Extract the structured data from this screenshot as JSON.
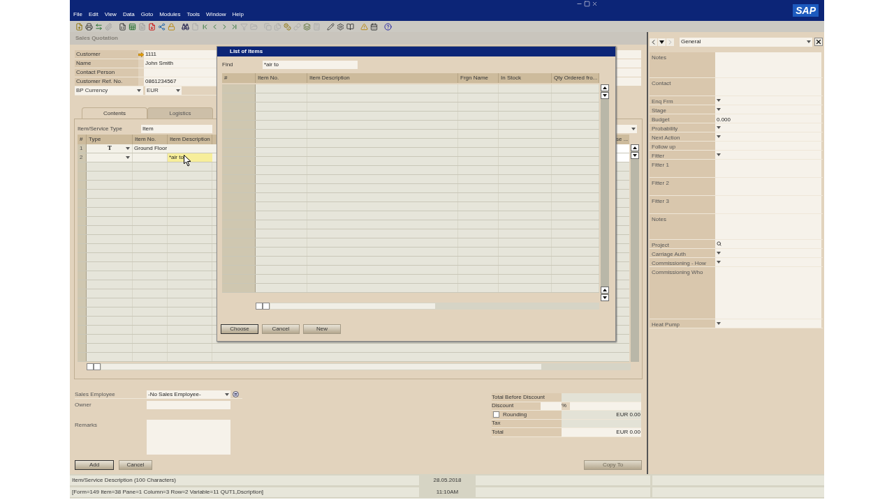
{
  "app": {
    "logo": "SAP"
  },
  "menu": [
    "File",
    "Edit",
    "View",
    "Data",
    "Goto",
    "Modules",
    "Tools",
    "Window",
    "Help"
  ],
  "sales_quotation": {
    "title": "Sales Quotation",
    "header_fields": [
      {
        "label": "Customer",
        "value": "1111",
        "kind": "link"
      },
      {
        "label": "Name",
        "value": "John Smith",
        "kind": "text"
      },
      {
        "label": "Contact Person",
        "kind": "text"
      },
      {
        "label": "Customer Ref. No.",
        "value": "0861234567",
        "kind": "text"
      },
      {
        "label": "BP Currency",
        "value": "EUR",
        "kind": "select"
      }
    ],
    "tabs": [
      {
        "label": "Contents",
        "selected": true
      },
      {
        "label": "Logistics",
        "selected": false
      }
    ],
    "item_service_type": {
      "label": "Item/Service Type",
      "value": "Item"
    },
    "grid": {
      "columns": [
        "#",
        "Type",
        "Item No.",
        "Item Description"
      ],
      "last_column": "se ...",
      "rows": [
        {
          "number": "1",
          "kind": "text",
          "type": "T",
          "item_no": "Ground Floor",
          "editing": false
        },
        {
          "number": "2",
          "kind": "item",
          "description": "*air to",
          "editing": true
        }
      ]
    },
    "sales_employee": {
      "label": "Sales Employee",
      "value": "-No Sales Employee-"
    },
    "owner": {
      "label": "Owner"
    },
    "remarks": {
      "label": "Remarks"
    },
    "totals": [
      {
        "label": "Total Before Discount",
        "kind": "readonly"
      },
      {
        "label": "Discount",
        "kind": "percent",
        "unit": "%"
      },
      {
        "label": "Rounding",
        "kind": "checkbox",
        "checked": false,
        "value": "EUR 0.00"
      },
      {
        "label": "Tax",
        "kind": "readonly"
      },
      {
        "label": "Total",
        "kind": "editable",
        "value": "EUR 0.00"
      }
    ],
    "buttons": [
      "Add",
      "Cancel"
    ],
    "copy_to": {
      "label": "Copy To",
      "disabled": true
    }
  },
  "list_of_items": {
    "title": "List of Items",
    "find": {
      "label": "Find",
      "value": "*air to"
    },
    "columns": [
      "#",
      "Item No.",
      "Item Description",
      "Frgn Name",
      "In Stock",
      "Qty Ordered fro..."
    ],
    "buttons": [
      "Choose",
      "Cancel",
      "New"
    ]
  },
  "side_panel": {
    "view": "General",
    "fields": [
      {
        "label": "Notes",
        "kind": "note"
      },
      {
        "label": "Contact",
        "kind": "box"
      },
      {
        "label": "Enq Frm",
        "kind": "select"
      },
      {
        "label": "Stage",
        "kind": "select"
      },
      {
        "label": "Budget",
        "kind": "line",
        "value": "0.000"
      },
      {
        "label": "Probability",
        "kind": "select"
      },
      {
        "label": "Next Action",
        "kind": "select"
      },
      {
        "label": "Follow up",
        "kind": "line"
      },
      {
        "label": "Fitter",
        "kind": "select"
      },
      {
        "label": "Fitter 1",
        "kind": "box"
      },
      {
        "label": "Fitter 2",
        "kind": "box"
      },
      {
        "label": "Fitter 3",
        "kind": "box"
      },
      {
        "label": "Notes",
        "kind": "note"
      },
      {
        "label": "Project",
        "kind": "lookup"
      },
      {
        "label": "Carriage Auth",
        "kind": "select"
      },
      {
        "label": "Commissioning - How",
        "kind": "select"
      },
      {
        "label": "Commissioning Who",
        "kind": "memo"
      },
      {
        "label": "Heat Pump",
        "kind": "select"
      }
    ]
  },
  "status_bar": {
    "message": "Item/Service Description (100 Characters)",
    "details": "[Form=149 Item=38 Pane=1 Column=3 Row=2 Variable=11 QUT1,Dscription]",
    "date": "28.05.2018",
    "time": "11:10AM"
  }
}
